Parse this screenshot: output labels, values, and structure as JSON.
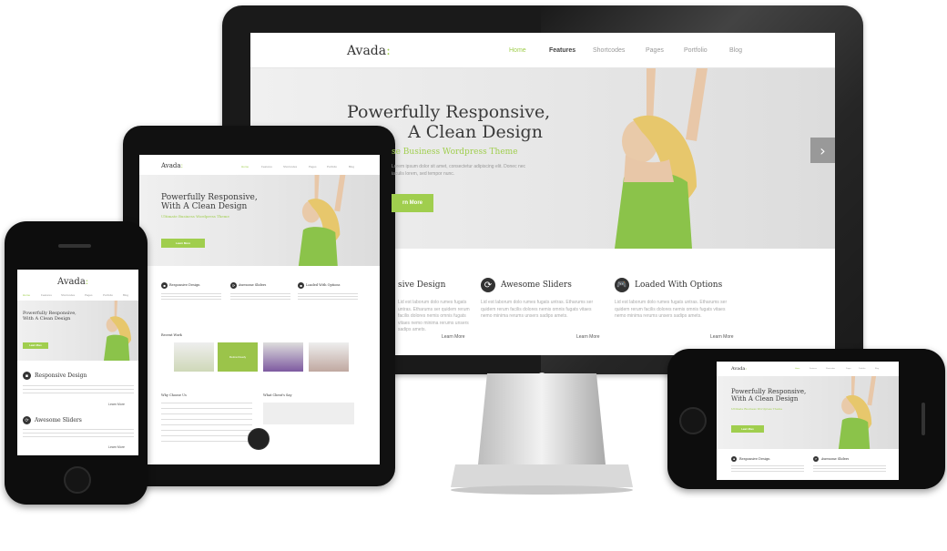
{
  "brand": {
    "logo": "Avada",
    "logo_dots": ":",
    "accent": "#a0ce4e"
  },
  "nav": [
    "Home",
    "Features",
    "Shortcodes",
    "Pages",
    "Portfolio",
    "Blog"
  ],
  "hero": {
    "title_line1": "Powerfully Responsive,",
    "title_line2": "With A Clean Design",
    "title_line2_partial": "A Clean Design",
    "subtitle": "Ultimate Business Wordpress Theme",
    "subtitle_partial": "se Business Wordpress Theme",
    "text": "Lorem ipsum dolor sit amet, consectetur adipiscing elit. Donec nec iaculis lorem, sed tempor nunc.",
    "button": "Learn More",
    "button_partial": "rn More",
    "next_arrow": "›"
  },
  "features": [
    {
      "title": "Responsive Design",
      "title_partial": "sive Design",
      "icon": "monitor-icon",
      "text": "Lid est laborum dolo rumes fugats untras. Etharums ser quidem rerum facilis dolores nemis omnis fugats vitaes nemo minima rerums unsers sadips amets.",
      "learn": "Learn More"
    },
    {
      "title": "Awesome Sliders",
      "icon": "refresh-icon",
      "text": "Lid est laborum dolo rumes fugats untras. Etharums ser quidem rerum facilis dolores nemis omnis fugats vitaes nemo minima rerums unsers sadips amets.",
      "learn": "Learn More"
    },
    {
      "title": "Loaded With Options",
      "icon": "gamepad-icon",
      "text": "Lid est laborum dolo rumes fugats untras. Etharums ser quidem rerum facilis dolores nemis omnis fugats vitaes nemo minima rerums unsers sadips amets.",
      "learn": "Learn More"
    }
  ],
  "tablet": {
    "recent_work": "Recent Work",
    "why_choose": "Why Choose Us",
    "what_clients": "What Client's Say",
    "ribbon": "Retina Ready",
    "features_short": [
      "Responsive Design",
      "Awesome Sliders",
      "Loaded With Options"
    ]
  },
  "phone": {
    "features": [
      "Responsive Design",
      "Awesome Sliders"
    ],
    "learn": "Learn More"
  },
  "landscape": {
    "features": [
      "Responsive Design",
      "Awesome Sliders"
    ]
  }
}
